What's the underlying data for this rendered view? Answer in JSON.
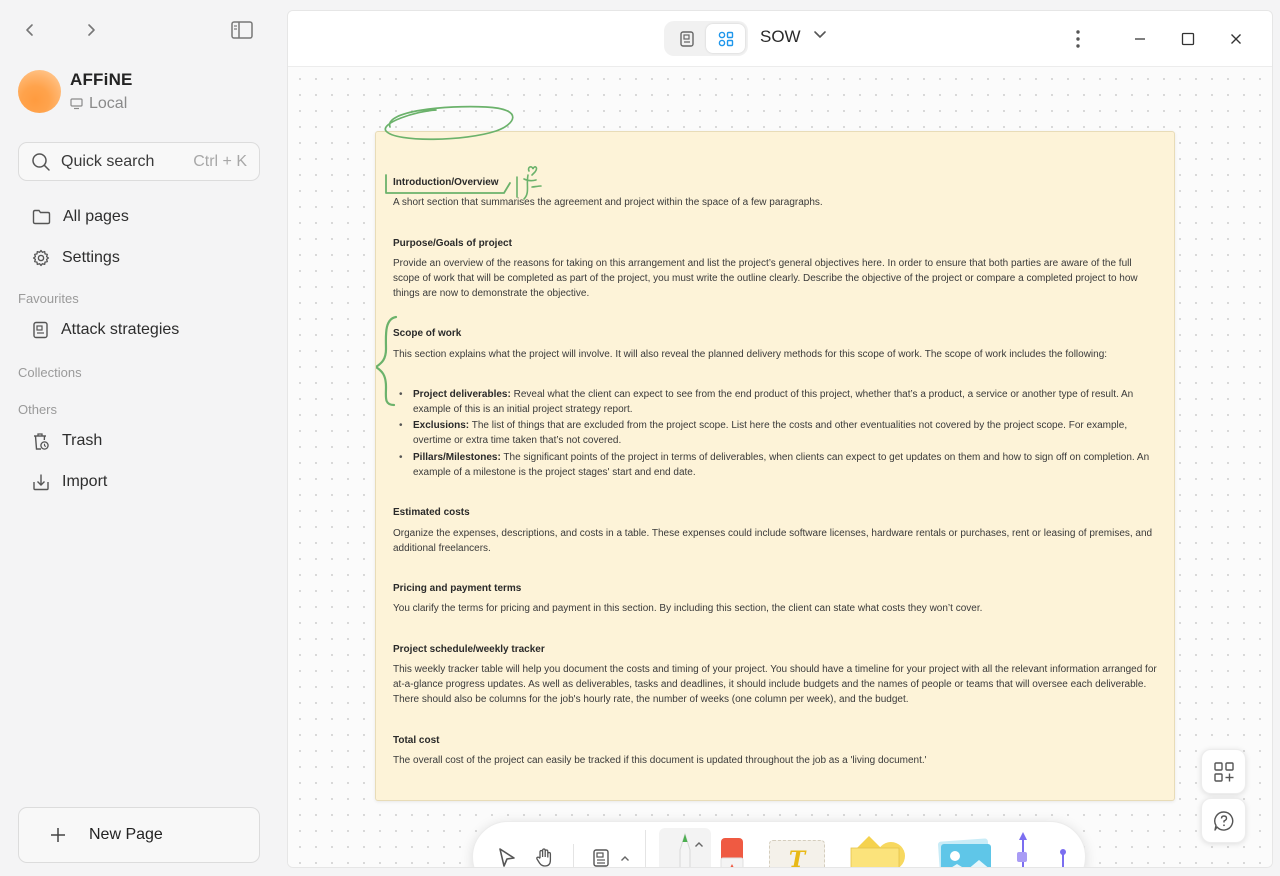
{
  "sidebar": {
    "workspace_name": "AFFiNE",
    "workspace_type": "Local",
    "search_label": "Quick search",
    "search_shortcut": "Ctrl + K",
    "all_pages": "All pages",
    "settings": "Settings",
    "favourites_heading": "Favourites",
    "favourite_item": "Attack strategies",
    "collections_heading": "Collections",
    "others_heading": "Others",
    "trash": "Trash",
    "import": "Import",
    "new_page": "New Page"
  },
  "header": {
    "doc_title": "SOW"
  },
  "note": {
    "s1_heading": "Introduction/Overview",
    "s1_text": "A short section that summarises the agreement and project within the space of a few paragraphs.",
    "s2_heading": "Purpose/Goals of project",
    "s2_text": "Provide an overview of the reasons for taking on this arrangement and list the project’s general objectives here. In order to ensure that both parties are aware of the full scope of work that will be completed as part of the project, you must write the outline clearly. Describe the objective of the project or compare a completed project to how things are now to demonstrate the objective.",
    "s3_heading": "Scope of work",
    "s3_text": "This section explains what the project will involve. It will also reveal the planned delivery methods for this scope of work. The scope of work includes the following:",
    "bullets": [
      {
        "title": "Project deliverables:",
        "text": " Reveal what the client can expect to see from the end product of this project, whether that’s a product, a service or another type of result. An example of this is an initial project strategy report."
      },
      {
        "title": "Exclusions:",
        "text": " The list of things that are excluded from the project scope. List here the costs and other eventualities not covered by the project scope. For example, overtime or extra time taken that’s not covered."
      },
      {
        "title": "Pillars/Milestones:",
        "text": " The significant points of the project in terms of deliverables, when clients can expect to get updates on them and how to sign off on completion. An example of a milestone is the project stages' start and end date."
      }
    ],
    "s4_heading": "Estimated costs",
    "s4_text": "Organize the expenses, descriptions, and costs in a table. These expenses could include software licenses, hardware rentals or purchases, rent or leasing of premises, and additional freelancers.",
    "s5_heading": "Pricing and payment terms",
    "s5_text": "You clarify the terms for pricing and payment in this section. By including this section, the client can state what costs they won’t cover.",
    "s6_heading": "Project schedule/weekly tracker",
    "s6_text": "This weekly tracker table will help you document the costs and timing of your project. You should have a timeline for your project with all the relevant information arranged for at-a-glance progress updates. As well as deliverables, tasks and deadlines, it should include budgets and the names of people or teams that will oversee each deliverable. There should also be columns for the job's hourly rate, the number of weeks (one column per week), and the budget.",
    "s7_heading": "Total cost",
    "s7_text": "The overall cost of the project can easily be tracked if this document is updated throughout the job as a 'living document.'"
  },
  "toolbar": {
    "text_tool_glyph": "T"
  },
  "colors": {
    "note_bg": "#fdf3d8",
    "scribble_green": "#6bb26b",
    "accent_blue": "#1e96eb"
  }
}
